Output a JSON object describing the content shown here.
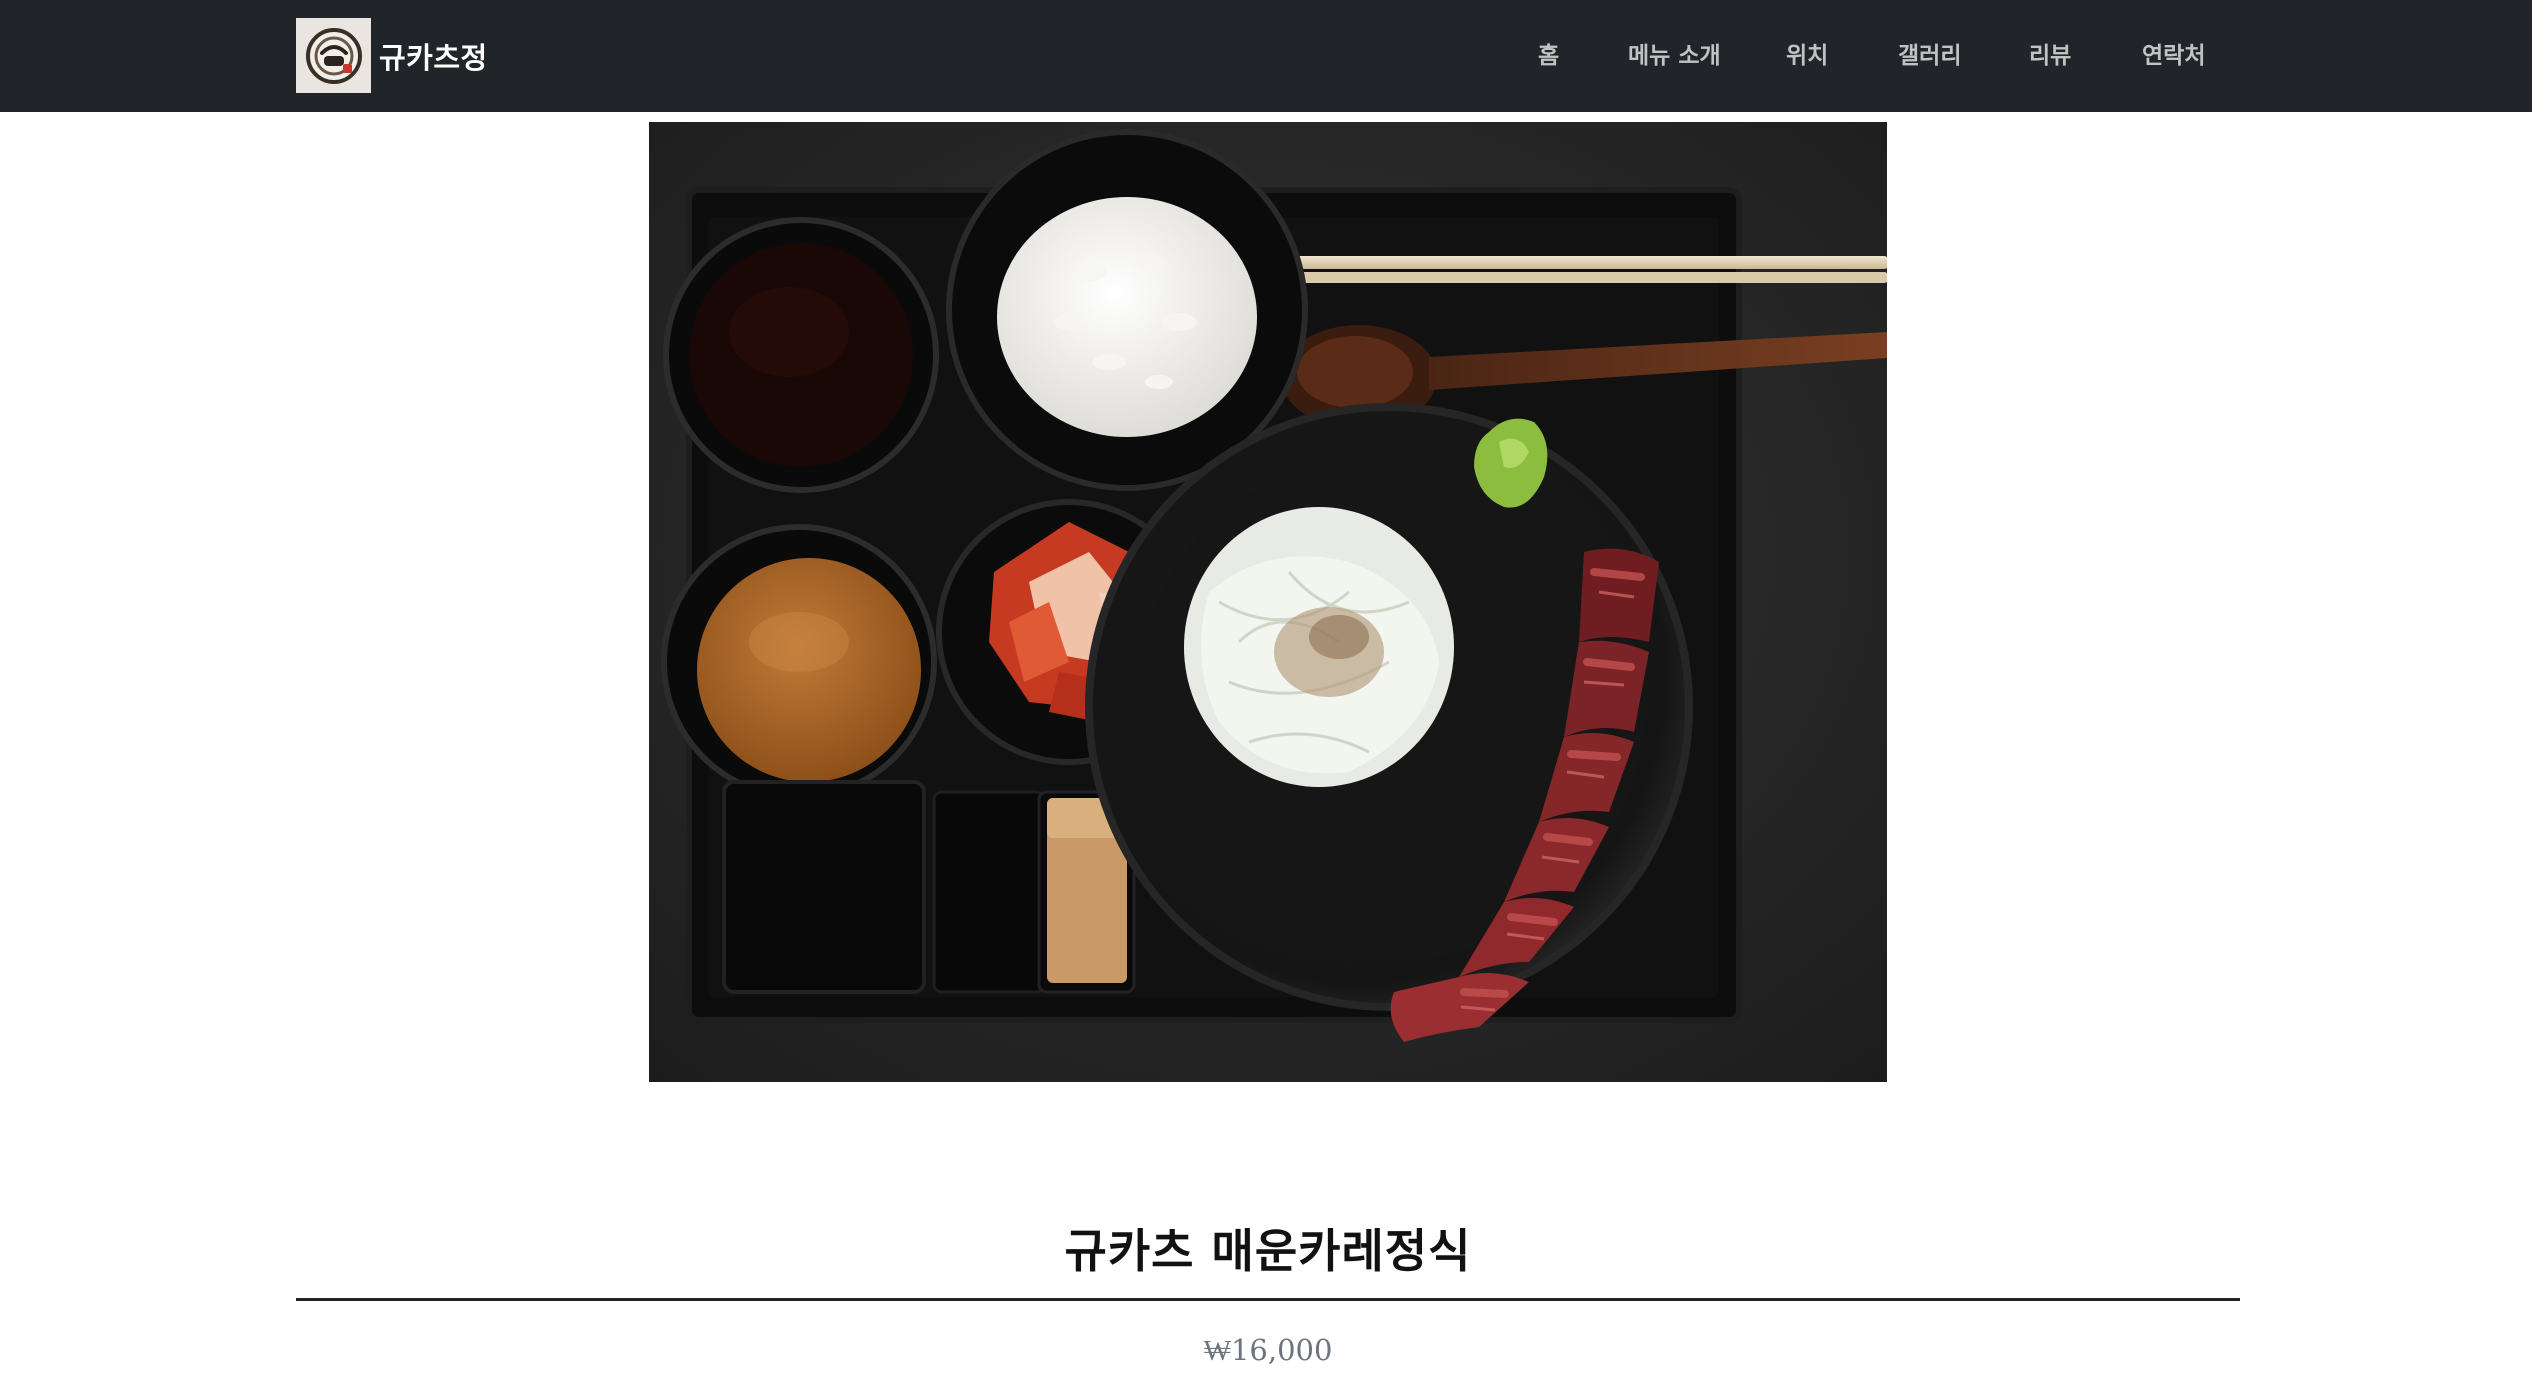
{
  "brand": {
    "name": "규카츠정",
    "logo_icon": "restaurant-seal-logo"
  },
  "nav": {
    "items": [
      {
        "label": "홈"
      },
      {
        "label": "메뉴 소개"
      },
      {
        "label": "위치"
      },
      {
        "label": "갤러리"
      },
      {
        "label": "리뷰"
      },
      {
        "label": "연락처"
      }
    ]
  },
  "hero": {
    "image_semantic": "gyukatsu-spicy-curry-set-photo"
  },
  "menu_item": {
    "title": "규카츠 매운카레정식",
    "price": "₩16,000"
  },
  "colors": {
    "navbar_bg": "#212529",
    "nav_text": "#c8c9ca",
    "title_text": "#111111",
    "price_text": "#6c757d"
  }
}
